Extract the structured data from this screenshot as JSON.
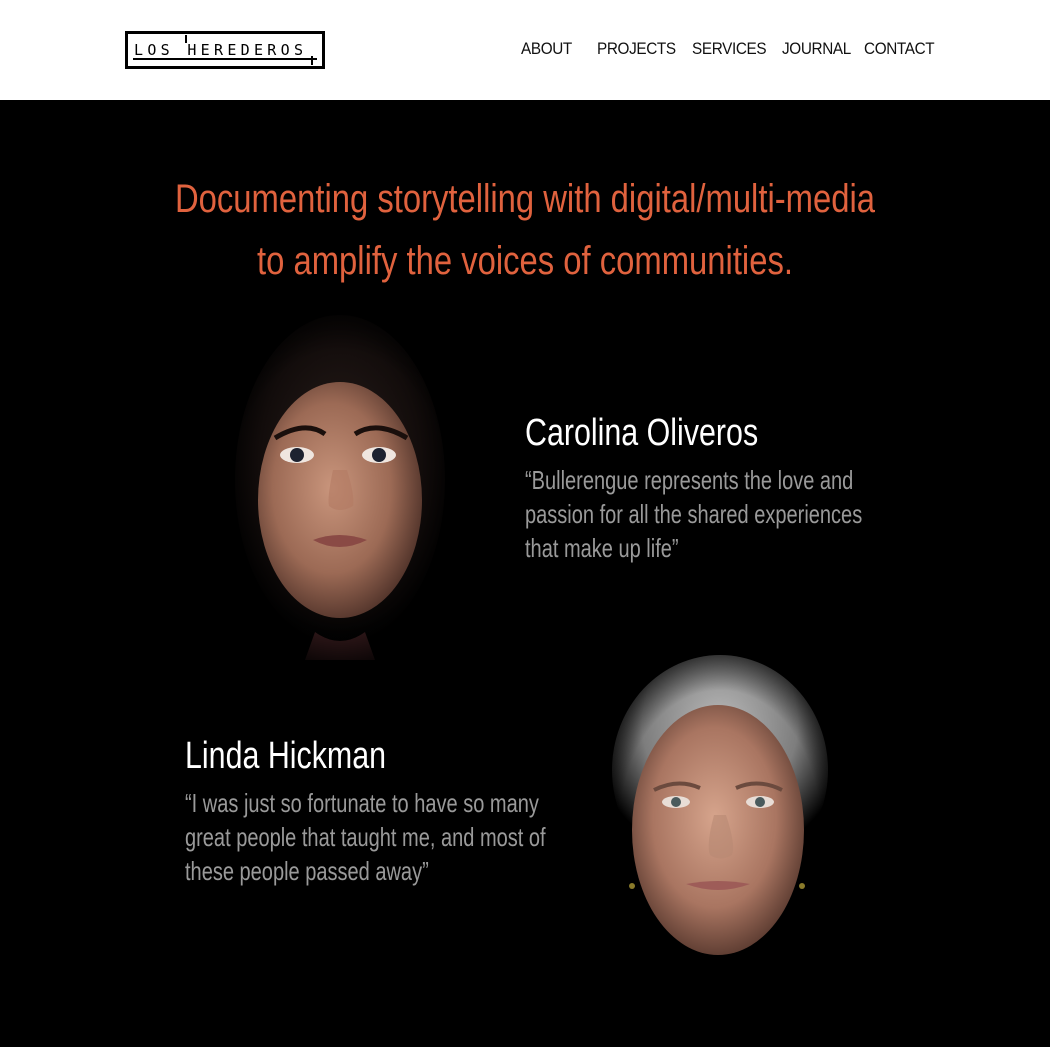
{
  "brand": {
    "logo_text": "LOS HEREDEROS"
  },
  "nav": {
    "about": "ABOUT",
    "projects": "PROJECTS",
    "services": "SERVICES",
    "journal": "JOURNAL",
    "contact": "CONTACT"
  },
  "hero": {
    "tagline_line1": "Documenting storytelling with digital/multi-media",
    "tagline_line2": "to amplify the voices of communities."
  },
  "profiles": [
    {
      "name": "Carolina Oliveros",
      "quote": "“Bullerengue represents the love and passion for all the shared experiences that make up life”"
    },
    {
      "name": "Linda Hickman",
      "quote": "“I was just so fortunate to have so many great people that taught me, and most of these people passed away”"
    }
  ],
  "colors": {
    "accent": "#e0623e",
    "background": "#000000",
    "header_bg": "#ffffff",
    "quote_text": "#9a9a9a"
  }
}
